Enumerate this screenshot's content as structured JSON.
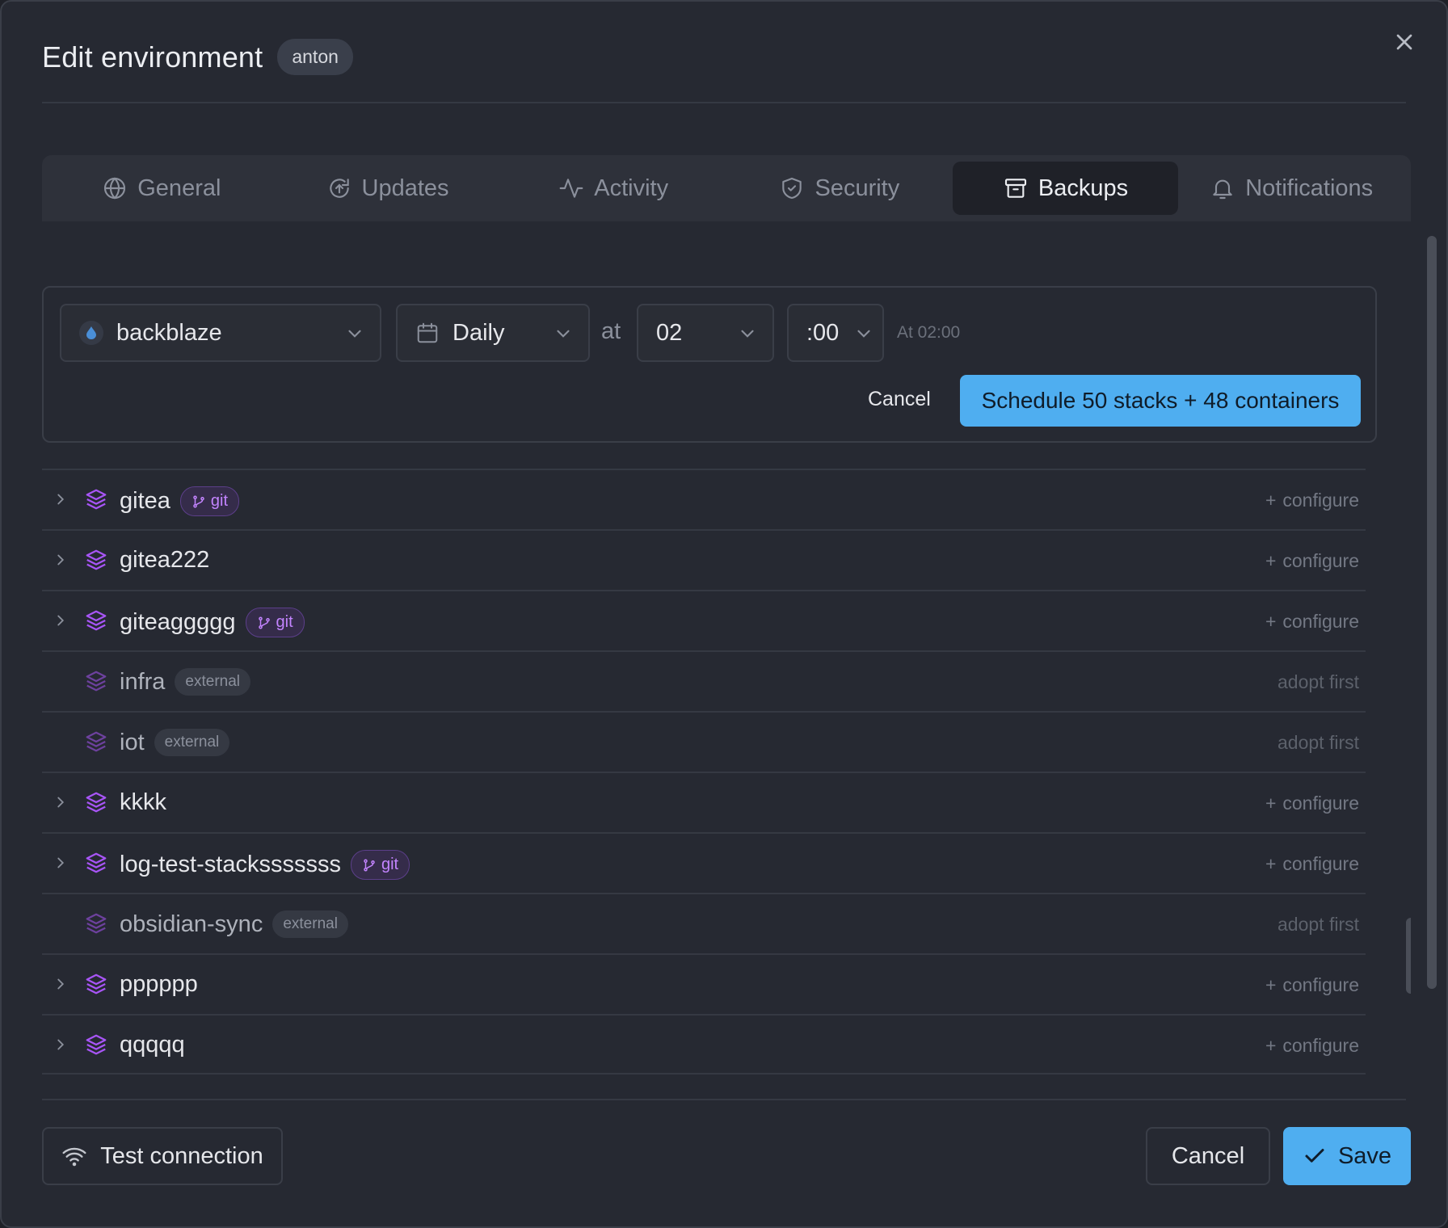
{
  "dialog": {
    "title": "Edit environment",
    "environment_badge": "anton"
  },
  "tabs": [
    {
      "label": "General",
      "icon": "globe-icon"
    },
    {
      "label": "Updates",
      "icon": "update-icon"
    },
    {
      "label": "Activity",
      "icon": "activity-icon"
    },
    {
      "label": "Security",
      "icon": "shield-icon"
    },
    {
      "label": "Backups",
      "icon": "archive-icon",
      "active": true
    },
    {
      "label": "Notifications",
      "icon": "bell-icon"
    }
  ],
  "schedule": {
    "provider": "backblaze",
    "frequency": "Daily",
    "at_label": "at",
    "hour": "02",
    "minute": ":00",
    "cron_hint": "At 02:00",
    "cancel_label": "Cancel",
    "submit_label": "Schedule 50 stacks + 48 containers"
  },
  "stacks": [
    {
      "name": "gitea",
      "badge": "git",
      "badge_type": "git",
      "expandable": true,
      "action": "configure"
    },
    {
      "name": "gitea222",
      "badge": "",
      "badge_type": "",
      "expandable": true,
      "action": "configure"
    },
    {
      "name": "giteaggggg",
      "badge": "git",
      "badge_type": "git",
      "expandable": true,
      "action": "configure"
    },
    {
      "name": "infra",
      "badge": "external",
      "badge_type": "external",
      "expandable": false,
      "action": "adopt first"
    },
    {
      "name": "iot",
      "badge": "external",
      "badge_type": "external",
      "expandable": false,
      "action": "adopt first"
    },
    {
      "name": "kkkk",
      "badge": "",
      "badge_type": "",
      "expandable": true,
      "action": "configure"
    },
    {
      "name": "log-test-stacksssssss",
      "badge": "git",
      "badge_type": "git",
      "expandable": true,
      "action": "configure"
    },
    {
      "name": "obsidian-sync",
      "badge": "external",
      "badge_type": "external",
      "expandable": false,
      "action": "adopt first"
    },
    {
      "name": "pppppp",
      "badge": "",
      "badge_type": "",
      "expandable": true,
      "action": "configure"
    },
    {
      "name": "qqqqq",
      "badge": "",
      "badge_type": "",
      "expandable": true,
      "action": "configure"
    }
  ],
  "footer": {
    "test_label": "Test connection",
    "cancel_label": "Cancel",
    "save_label": "Save"
  },
  "colors": {
    "accent": "#4faef0",
    "stack_icon": "#a855f7",
    "git_badge": "#c384ff"
  }
}
